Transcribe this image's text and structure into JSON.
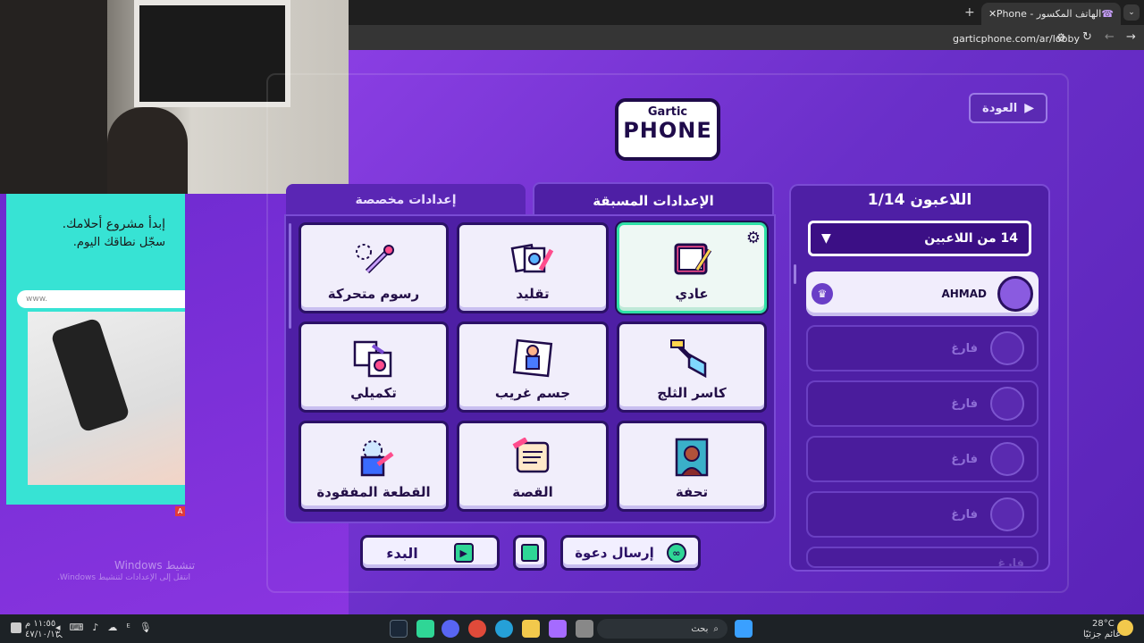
{
  "browser": {
    "tab_title": "الهاتف المكسور - Gartic Phone",
    "url": "garticphone.com/ar/lobby"
  },
  "logo": {
    "top": "Gartic",
    "bottom": "PHONE"
  },
  "back_label": "العودة",
  "players": {
    "title": "اللاعبون 1/14",
    "dropdown": "14 من اللاعبين",
    "host": "AHMAD",
    "empty": "فارغ"
  },
  "tabs": {
    "preset": "الإعدادات المسبقة",
    "custom": "إعدادات مخصصة"
  },
  "modes": [
    "عادي",
    "تقليد",
    "رسوم متحركة",
    "كاسر الثلج",
    "جسم غريب",
    "تكميلي",
    "تحفة",
    "القصة",
    "القطعة المفقودة"
  ],
  "buttons": {
    "start": "البدء",
    "invite": "إرسال دعوة"
  },
  "ad": {
    "line1": "إبدأ مشروع أحلامك.",
    "line2": "سجّل نطاقك اليوم.",
    "www": "www."
  },
  "windows": {
    "activate": "تنشيط Windows",
    "hint": "انتقل إلى الإعدادات لتنشيط Windows."
  },
  "taskbar": {
    "search": "بحث",
    "weather_temp": "28°C",
    "weather_text": "غائم جزئيًا",
    "time": "١١:٥٥ م",
    "date": "٤٧/١٠/١٣"
  },
  "colors": {
    "accent": "#2fe0a6",
    "brand": "#6a2fc9"
  }
}
